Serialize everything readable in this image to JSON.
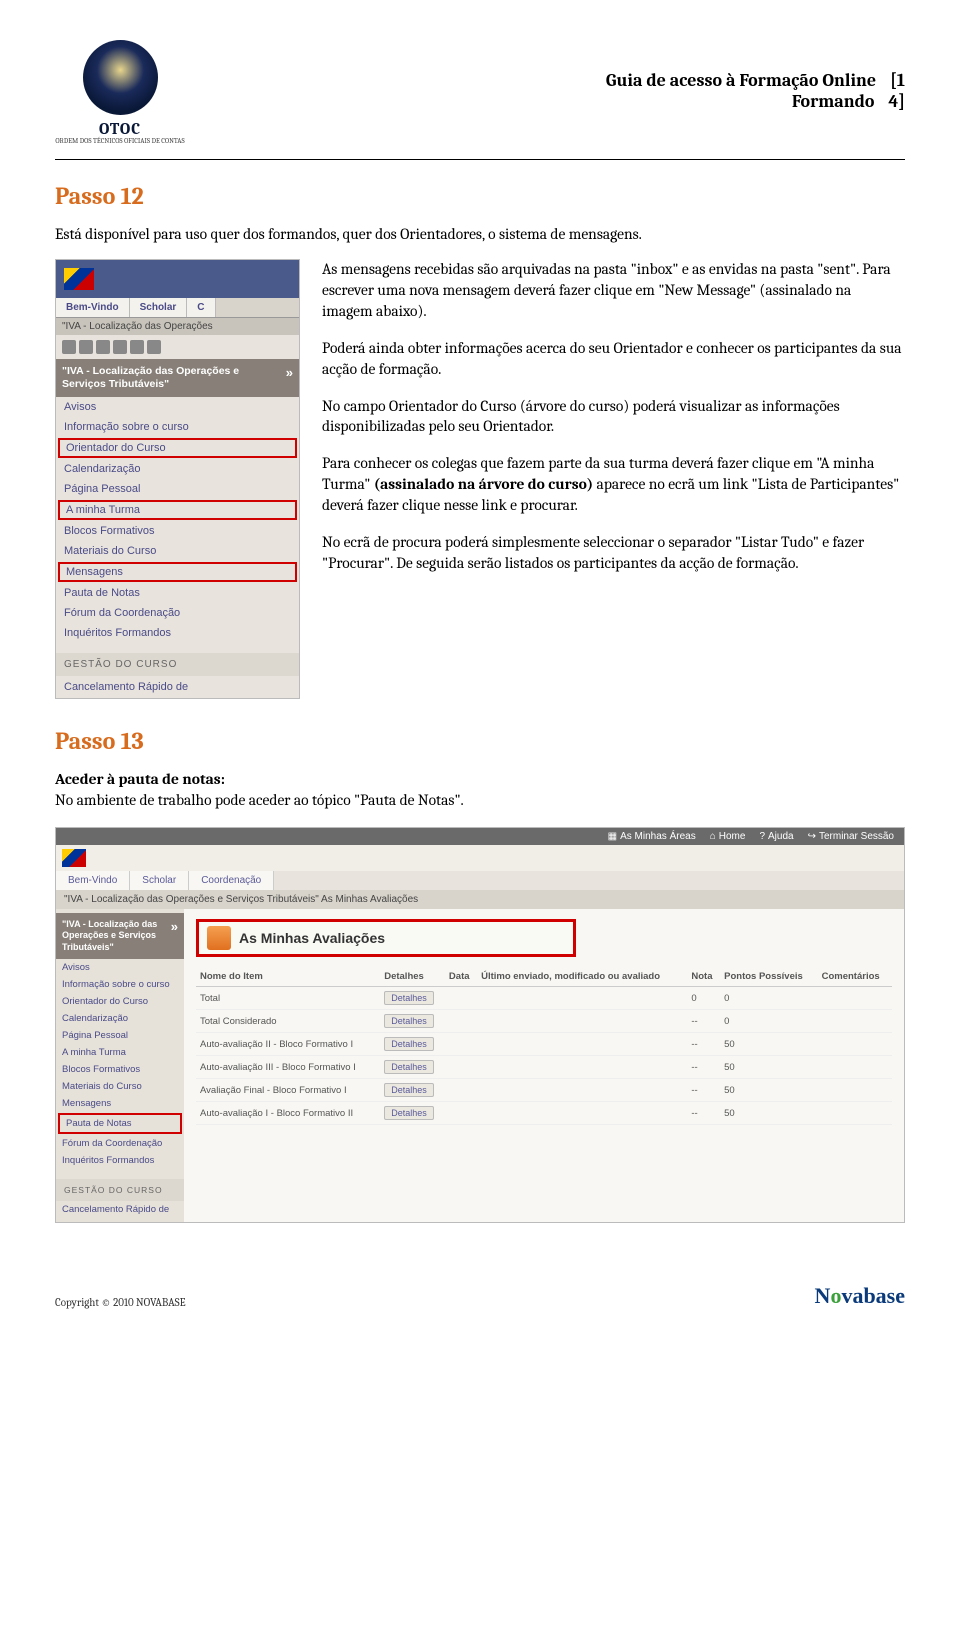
{
  "header": {
    "org_name": "OTOC",
    "org_sub": "ORDEM DOS TÉCNICOS OFICIAIS DE CONTAS",
    "title1": "Guia de acesso à Formação Online",
    "title2": "Formando",
    "code1": "[1",
    "code2": "4]"
  },
  "passo12": {
    "heading": "Passo 12",
    "intro": "Está disponível para uso quer dos formandos, quer dos Orientadores, o sistema de mensagens.",
    "paragraphs": [
      "As mensagens recebidas são arquivadas na pasta \"inbox\" e as envidas na pasta \"sent\". Para escrever uma nova mensagem deverá fazer clique em \"New Message\" (assinalado na imagem abaixo).",
      "Poderá ainda obter informações acerca do seu Orientador e conhecer os participantes da sua acção de formação.",
      "No campo Orientador do Curso (árvore do curso) poderá visualizar as informações disponibilizadas pelo seu Orientador.",
      "Para conhecer os colegas que fazem parte da sua turma deverá fazer clique em \"A minha Turma\" (assinalado na árvore do curso) aparece no ecrã um link \"Lista de Participantes\" deverá fazer clique nesse link e procurar.",
      "No ecrã de procura poderá simplesmente seleccionar o separador \"Listar Tudo\" e fazer \"Procurar\". De seguida serão listados os participantes da acção de formação."
    ]
  },
  "sidebar_mock": {
    "tabs": [
      "Bem-Vindo",
      "Scholar",
      "C"
    ],
    "bar": "\"IVA - Localização das Operações",
    "course_title": "\"IVA - Localização das Operações e Serviços Tributáveis\"",
    "links": [
      {
        "label": "Avisos",
        "hl": false
      },
      {
        "label": "Informação sobre o curso",
        "hl": false
      },
      {
        "label": "Orientador do Curso",
        "hl": true
      },
      {
        "label": "Calendarização",
        "hl": false
      },
      {
        "label": "Página Pessoal",
        "hl": false
      },
      {
        "label": "A minha Turma",
        "hl": true
      },
      {
        "label": "Blocos Formativos",
        "hl": false
      },
      {
        "label": "Materiais do Curso",
        "hl": false
      },
      {
        "label": "Mensagens",
        "hl": true
      },
      {
        "label": "Pauta de Notas",
        "hl": false
      },
      {
        "label": "Fórum da Coordenação",
        "hl": false
      },
      {
        "label": "Inquéritos Formandos",
        "hl": false
      }
    ],
    "manage": "GESTÃO DO CURSO",
    "cancel": "Cancelamento Rápido de"
  },
  "passo13": {
    "heading": "Passo 13",
    "intro_bold": "Aceder à pauta de notas:",
    "intro_rest": "No ambiente de trabalho pode aceder ao tópico \"Pauta de Notas\"."
  },
  "wide_mock": {
    "topbar": [
      "As Minhas Áreas",
      "Home",
      "Ajuda",
      "Terminar Sessão"
    ],
    "tabs": [
      "Bem-Vindo",
      "Scholar",
      "Coordenação"
    ],
    "bread": "\"IVA - Localização das Operações e Serviços Tributáveis\"   As Minhas Avaliações",
    "side_course": "\"IVA - Localização das Operações e Serviços Tributáveis\"",
    "side_links": [
      {
        "label": "Avisos",
        "hl": false
      },
      {
        "label": "Informação sobre o curso",
        "hl": false
      },
      {
        "label": "Orientador do Curso",
        "hl": false
      },
      {
        "label": "Calendarização",
        "hl": false
      },
      {
        "label": "Página Pessoal",
        "hl": false
      },
      {
        "label": "A minha Turma",
        "hl": false
      },
      {
        "label": "Blocos Formativos",
        "hl": false
      },
      {
        "label": "Materiais do Curso",
        "hl": false
      },
      {
        "label": "Mensagens",
        "hl": false
      },
      {
        "label": "Pauta de Notas",
        "hl": true
      },
      {
        "label": "Fórum da Coordenação",
        "hl": false
      },
      {
        "label": "Inquéritos Formandos",
        "hl": false
      }
    ],
    "side_manage": "GESTÃO DO CURSO",
    "side_cancel": "Cancelamento Rápido de",
    "main_title": "As Minhas Avaliações",
    "table": {
      "headers": [
        "Nome do Item",
        "Detalhes",
        "Data",
        "Último enviado, modificado ou avaliado",
        "Nota",
        "Pontos Possíveis",
        "Comentários"
      ],
      "rows": [
        {
          "name": "Total",
          "btn": "Detalhes",
          "date": "",
          "last": "",
          "nota": "0",
          "pts": "0",
          "com": ""
        },
        {
          "name": "Total Considerado",
          "btn": "Detalhes",
          "date": "",
          "last": "",
          "nota": "--",
          "pts": "0",
          "com": ""
        },
        {
          "name": "Auto-avaliação II - Bloco Formativo I",
          "btn": "Detalhes",
          "date": "",
          "last": "",
          "nota": "--",
          "pts": "50",
          "com": ""
        },
        {
          "name": "Auto-avaliação III - Bloco Formativo I",
          "btn": "Detalhes",
          "date": "",
          "last": "",
          "nota": "--",
          "pts": "50",
          "com": ""
        },
        {
          "name": "Avaliação Final - Bloco Formativo I",
          "btn": "Detalhes",
          "date": "",
          "last": "",
          "nota": "--",
          "pts": "50",
          "com": ""
        },
        {
          "name": "Auto-avaliação I - Bloco Formativo II",
          "btn": "Detalhes",
          "date": "",
          "last": "",
          "nota": "--",
          "pts": "50",
          "com": ""
        }
      ]
    }
  },
  "footer": {
    "copyright": "Copyright © 2010 NOVABASE",
    "brand_pre": "N",
    "brand_o": "o",
    "brand_post": "vabase"
  }
}
